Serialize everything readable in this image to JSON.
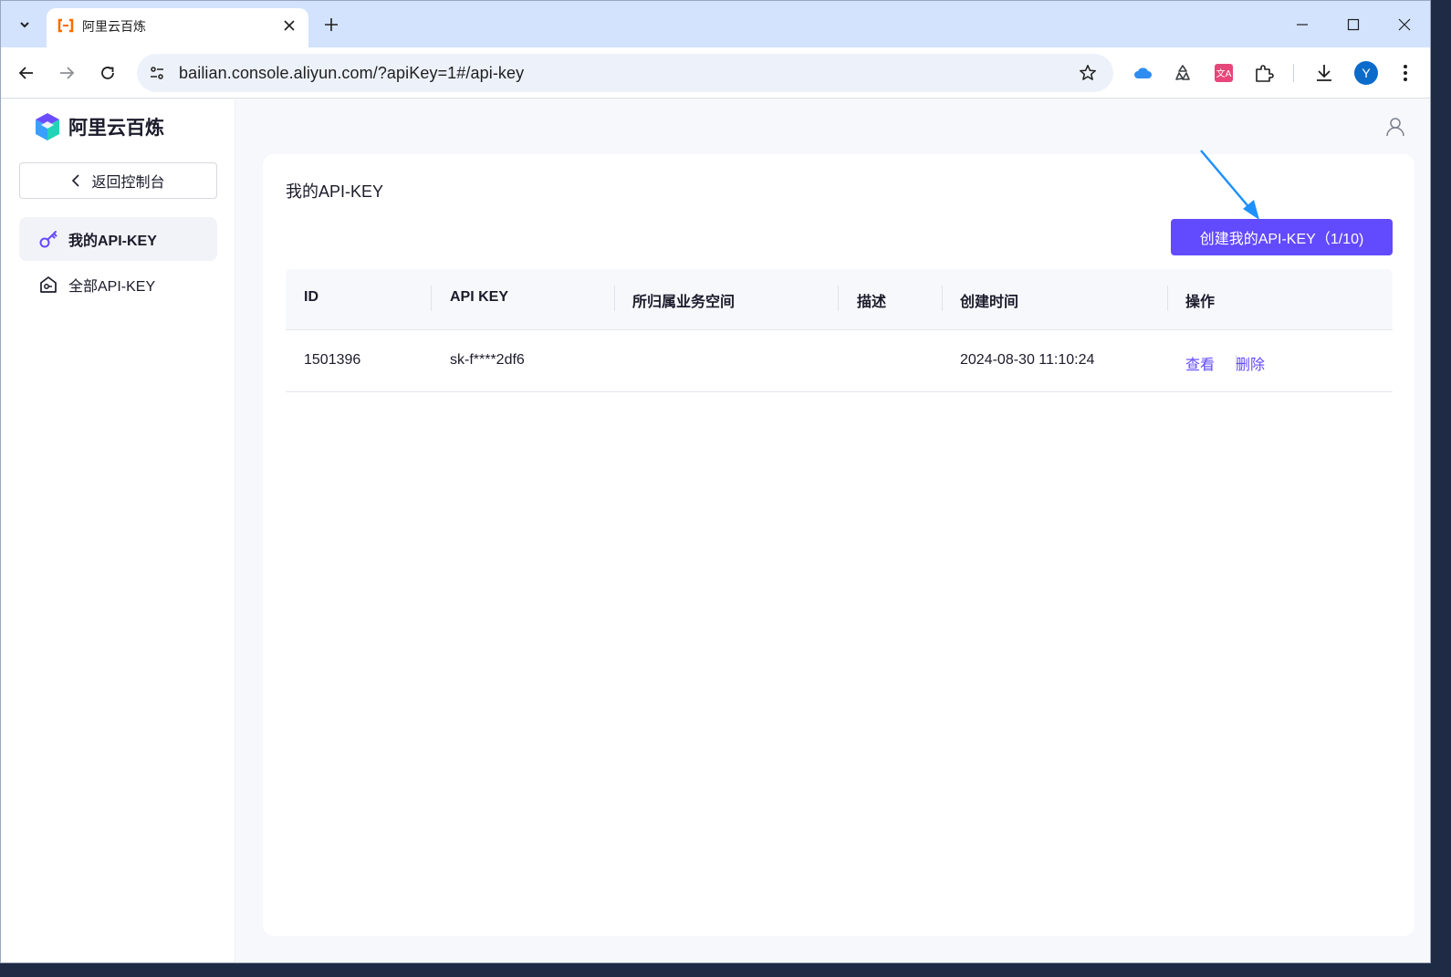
{
  "browser": {
    "tab_title": "阿里云百炼",
    "url": "bailian.console.aliyun.com/?apiKey=1#/api-key",
    "profile_initial": "Y"
  },
  "sidebar": {
    "brand_name": "阿里云百炼",
    "back_label": "返回控制台",
    "items": [
      {
        "label": "我的API-KEY",
        "active": true
      },
      {
        "label": "全部API-KEY",
        "active": false
      }
    ]
  },
  "main": {
    "title": "我的API-KEY",
    "create_button": "创建我的API-KEY（1/10)",
    "table": {
      "columns": [
        "ID",
        "API KEY",
        "所归属业务空间",
        "描述",
        "创建时间",
        "操作"
      ],
      "rows": [
        {
          "id": "1501396",
          "api_key": "sk-f****2df6",
          "workspace": "",
          "description": "",
          "created_at": "2024-08-30 11:10:24",
          "actions": [
            "查看",
            "删除"
          ]
        }
      ]
    }
  },
  "colors": {
    "accent": "#624aff",
    "annotation_arrow": "#1e90ff"
  }
}
